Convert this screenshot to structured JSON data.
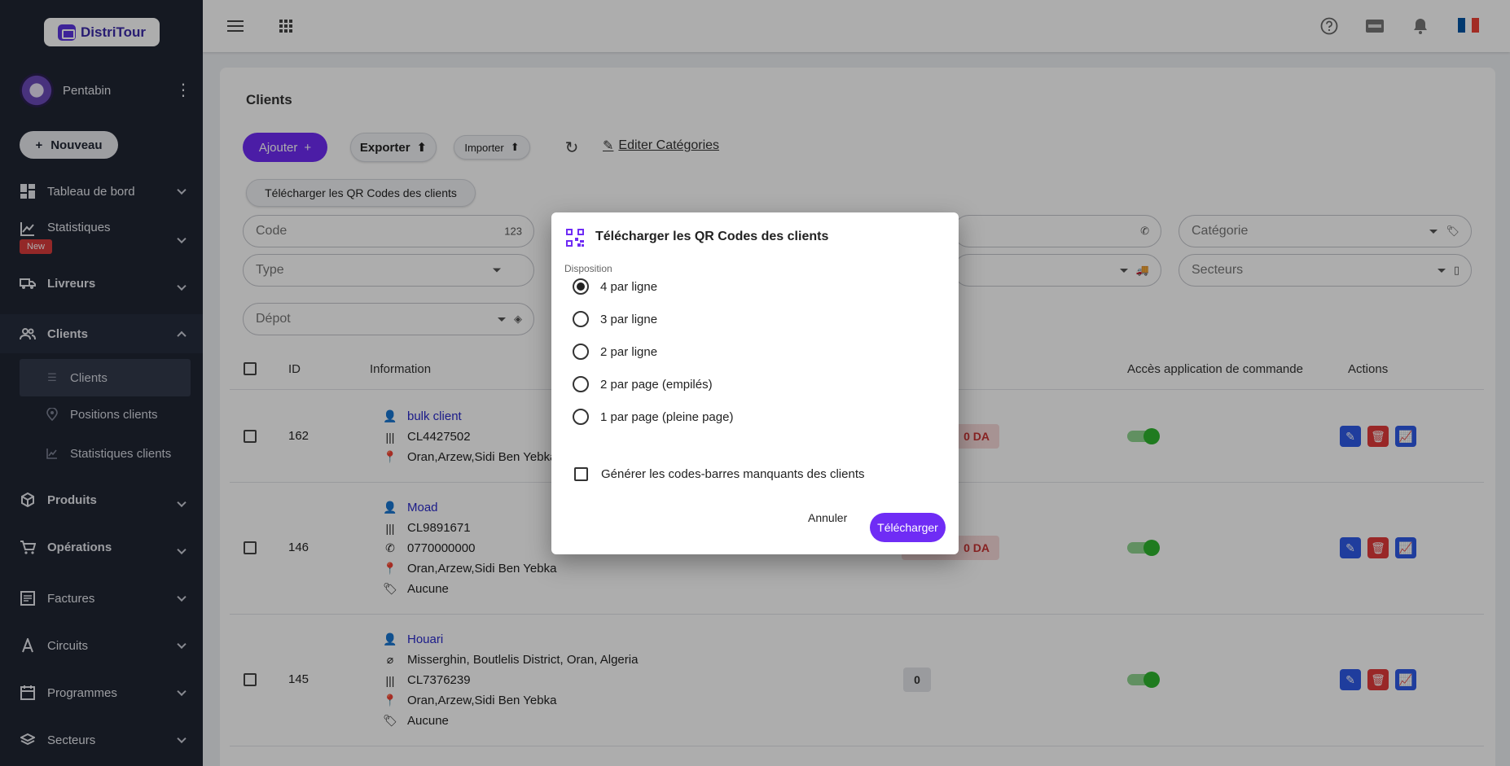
{
  "brand": {
    "name": "DistriTour"
  },
  "user": {
    "name": "Pentabin"
  },
  "sidebar": {
    "new_button": "Nouveau",
    "new_badge": "New",
    "items": [
      {
        "label": "Tableau de bord",
        "icon": "dashboard-icon"
      },
      {
        "label": "Statistiques",
        "icon": "chart-line-icon"
      },
      {
        "label": "Livreurs",
        "icon": "truck-icon"
      },
      {
        "label": "Clients",
        "icon": "people-icon"
      },
      {
        "label": "Produits",
        "icon": "box-icon"
      },
      {
        "label": "Opérations",
        "icon": "cart-icon"
      },
      {
        "label": "Factures",
        "icon": "receipt-icon"
      },
      {
        "label": "Circuits",
        "icon": "route-icon"
      },
      {
        "label": "Programmes",
        "icon": "calendar-icon"
      },
      {
        "label": "Secteurs",
        "icon": "layers-icon"
      }
    ],
    "sub_items": [
      {
        "label": "Clients"
      },
      {
        "label": "Positions clients"
      },
      {
        "label": "Statistiques clients"
      }
    ]
  },
  "topbar": {
    "flag_colors": [
      "#0055A4",
      "#FFFFFF",
      "#EF4135"
    ]
  },
  "page": {
    "title": "Clients",
    "add_button": "Ajouter",
    "export_button": "Exporter",
    "import_button": "Importer",
    "edit_categories": "Editer Catégories",
    "qr_button": "Télécharger les QR Codes des clients"
  },
  "filters": {
    "code": "Code",
    "code_suffix": "123",
    "category": "Catégorie",
    "type": "Type",
    "sectors": "Secteurs",
    "depot": "Dépot"
  },
  "table": {
    "headers": {
      "id": "ID",
      "information": "Information",
      "access": "Accès application de commande",
      "actions": "Actions"
    },
    "rows": [
      {
        "id": "162",
        "name": "bulk client",
        "code": "CL4427502",
        "address": "Oran,Arzew,Sidi Ben Yebka",
        "balance": "0 DA"
      },
      {
        "id": "146",
        "name": "Moad",
        "code": "CL9891671",
        "phone": "0770000000",
        "address": "Oran,Arzew,Sidi Ben Yebka",
        "category": "Aucune",
        "balance": "0 DA"
      },
      {
        "id": "145",
        "name": "Houari",
        "location": "Misserghin, Boutlelis District, Oran, Algeria",
        "code": "CL7376239",
        "address": "Oran,Arzew,Sidi Ben Yebka",
        "category": "Aucune",
        "balance": "0"
      }
    ]
  },
  "dialog": {
    "title": "Télécharger les QR Codes des clients",
    "section_label": "Disposition",
    "options": [
      "4 par ligne",
      "3 par ligne",
      "2 par ligne",
      "2 par page (empilés)",
      "1 par page (pleine page)"
    ],
    "selected_index": 0,
    "checkbox_label": "Générer les codes-barres manquants des clients",
    "cancel": "Annuler",
    "confirm": "Télécharger",
    "accent": "#6f2cf5"
  }
}
